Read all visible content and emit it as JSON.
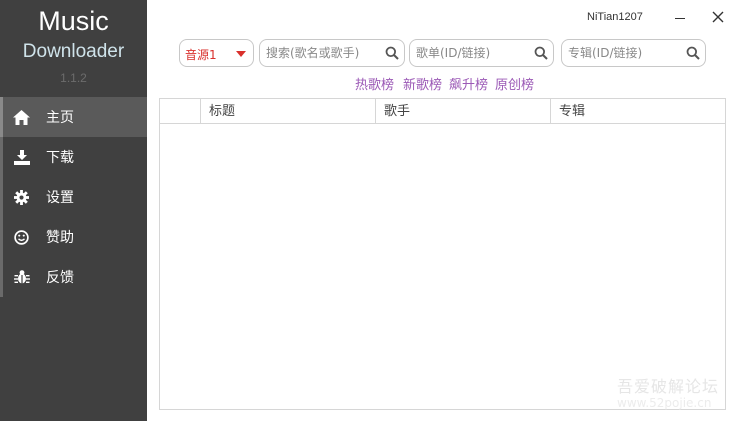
{
  "app": {
    "logo_line1": "Music",
    "logo_line2": "Downloader",
    "version": "1.1.2"
  },
  "sidebar": {
    "items": [
      {
        "label": "主页",
        "icon": "home-icon"
      },
      {
        "label": "下载",
        "icon": "download-icon"
      },
      {
        "label": "设置",
        "icon": "gear-icon"
      },
      {
        "label": "赞助",
        "icon": "smile-icon"
      },
      {
        "label": "反馈",
        "icon": "bug-icon"
      }
    ],
    "active_index": 0
  },
  "titlebar": {
    "username": "NiTian1207"
  },
  "toolbar": {
    "source_value": "音源1",
    "search_song_placeholder": "搜索(歌名或歌手)",
    "playlist_placeholder": "歌单(ID/链接)",
    "album_placeholder": "专辑(ID/链接)"
  },
  "charts": [
    "热歌榜",
    "新歌榜",
    "飙升榜",
    "原创榜"
  ],
  "table": {
    "columns": [
      "",
      "标题",
      "歌手",
      "专辑"
    ],
    "rows": []
  },
  "watermark": {
    "line1": "吾爱破解论坛",
    "line2": "www.52pojie.cn"
  },
  "colors": {
    "sidebar_bg": "#404040",
    "sidebar_active": "#5a5a5a",
    "accent_red": "#d9302c",
    "link_purple": "#9b59b6"
  }
}
